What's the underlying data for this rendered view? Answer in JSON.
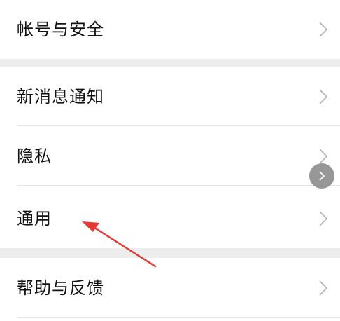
{
  "settings": {
    "items": [
      {
        "label": "帐号与安全"
      },
      {
        "label": "新消息通知"
      },
      {
        "label": "隐私"
      },
      {
        "label": "通用"
      },
      {
        "label": "帮助与反馈"
      }
    ]
  },
  "icons": {
    "chevron": "chevron-right-icon",
    "floating": "floating-chevron-right-icon"
  },
  "colors": {
    "background": "#ffffff",
    "section_gap": "#ededed",
    "divider": "#e5e5e5",
    "text": "#111111",
    "chevron": "#b2b2b2",
    "annotation": "#e53935"
  }
}
